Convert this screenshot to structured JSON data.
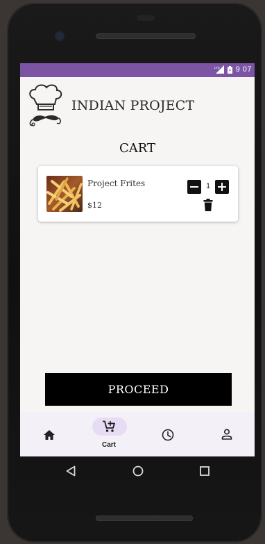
{
  "status_bar": {
    "time": "9 07",
    "network_label": "LTE"
  },
  "app": {
    "title": "INDIAN PROJECT",
    "logo_icon": "chef-hat-mustache-logo"
  },
  "page": {
    "title": "CART"
  },
  "cart": {
    "items": [
      {
        "name": "Project Frites",
        "price": "$12",
        "quantity": "1",
        "image_icon": "french-fries-photo"
      }
    ]
  },
  "actions": {
    "proceed_label": "PROCEED"
  },
  "bottom_nav": {
    "items": [
      {
        "id": "home",
        "label": "",
        "icon": "home-icon",
        "active": false
      },
      {
        "id": "cart",
        "label": "Cart",
        "icon": "cart-add-icon",
        "active": true
      },
      {
        "id": "history",
        "label": "",
        "icon": "clock-icon",
        "active": false
      },
      {
        "id": "profile",
        "label": "",
        "icon": "person-icon",
        "active": false
      }
    ]
  },
  "colors": {
    "status_bar": "#7b55a4",
    "screen_bg": "#f6f5f3",
    "nav_bg": "#f4f0f7",
    "active_pill": "#e7dcf3",
    "button_bg": "#000000"
  }
}
